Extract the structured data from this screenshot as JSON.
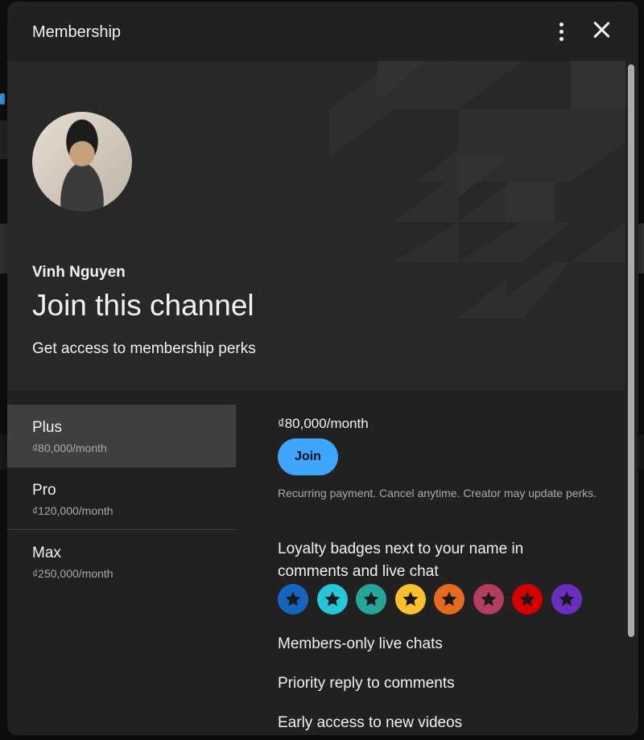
{
  "dialog": {
    "title": "Membership",
    "more_icon": "more-vertical-icon",
    "close_icon": "close-icon"
  },
  "hero": {
    "channel_name": "Vinh Nguyen",
    "title": "Join this channel",
    "subtitle": "Get access to membership perks"
  },
  "tiers": [
    {
      "name": "Plus",
      "price": "₫80,000/month",
      "selected": true
    },
    {
      "name": "Pro",
      "price": "₫120,000/month",
      "selected": false
    },
    {
      "name": "Max",
      "price": "₫250,000/month",
      "selected": false
    }
  ],
  "detail": {
    "price": "₫80,000/month",
    "join_label": "Join",
    "note": "Recurring payment. Cancel anytime. Creator may update perks.",
    "perk_badges": "Loyalty badges next to your name in comments and live chat",
    "badge_colors": [
      "#1565c0",
      "#26c6da",
      "#26a69a",
      "#fbc02d",
      "#e66a1f",
      "#b23f5f",
      "#d50000",
      "#6a2fbf"
    ],
    "perks": [
      "Members-only live chats",
      "Priority reply to comments",
      "Early access to new videos"
    ]
  },
  "colors": {
    "accent": "#3ea6ff",
    "surface": "#212121",
    "hero": "#282828"
  }
}
